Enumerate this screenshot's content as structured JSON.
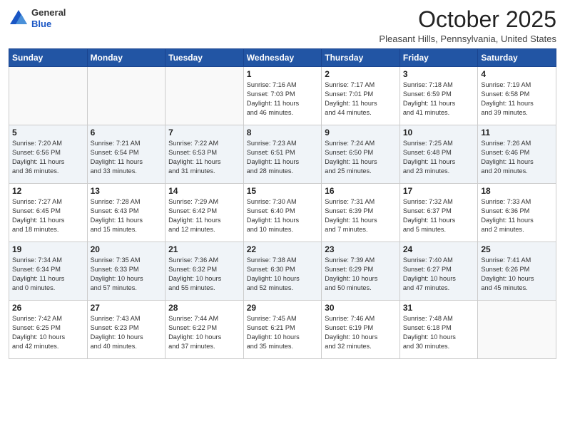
{
  "header": {
    "logo_general": "General",
    "logo_blue": "Blue",
    "month": "October 2025",
    "location": "Pleasant Hills, Pennsylvania, United States"
  },
  "days_of_week": [
    "Sunday",
    "Monday",
    "Tuesday",
    "Wednesday",
    "Thursday",
    "Friday",
    "Saturday"
  ],
  "weeks": [
    [
      {
        "num": "",
        "info": ""
      },
      {
        "num": "",
        "info": ""
      },
      {
        "num": "",
        "info": ""
      },
      {
        "num": "1",
        "info": "Sunrise: 7:16 AM\nSunset: 7:03 PM\nDaylight: 11 hours\nand 46 minutes."
      },
      {
        "num": "2",
        "info": "Sunrise: 7:17 AM\nSunset: 7:01 PM\nDaylight: 11 hours\nand 44 minutes."
      },
      {
        "num": "3",
        "info": "Sunrise: 7:18 AM\nSunset: 6:59 PM\nDaylight: 11 hours\nand 41 minutes."
      },
      {
        "num": "4",
        "info": "Sunrise: 7:19 AM\nSunset: 6:58 PM\nDaylight: 11 hours\nand 39 minutes."
      }
    ],
    [
      {
        "num": "5",
        "info": "Sunrise: 7:20 AM\nSunset: 6:56 PM\nDaylight: 11 hours\nand 36 minutes."
      },
      {
        "num": "6",
        "info": "Sunrise: 7:21 AM\nSunset: 6:54 PM\nDaylight: 11 hours\nand 33 minutes."
      },
      {
        "num": "7",
        "info": "Sunrise: 7:22 AM\nSunset: 6:53 PM\nDaylight: 11 hours\nand 31 minutes."
      },
      {
        "num": "8",
        "info": "Sunrise: 7:23 AM\nSunset: 6:51 PM\nDaylight: 11 hours\nand 28 minutes."
      },
      {
        "num": "9",
        "info": "Sunrise: 7:24 AM\nSunset: 6:50 PM\nDaylight: 11 hours\nand 25 minutes."
      },
      {
        "num": "10",
        "info": "Sunrise: 7:25 AM\nSunset: 6:48 PM\nDaylight: 11 hours\nand 23 minutes."
      },
      {
        "num": "11",
        "info": "Sunrise: 7:26 AM\nSunset: 6:46 PM\nDaylight: 11 hours\nand 20 minutes."
      }
    ],
    [
      {
        "num": "12",
        "info": "Sunrise: 7:27 AM\nSunset: 6:45 PM\nDaylight: 11 hours\nand 18 minutes."
      },
      {
        "num": "13",
        "info": "Sunrise: 7:28 AM\nSunset: 6:43 PM\nDaylight: 11 hours\nand 15 minutes."
      },
      {
        "num": "14",
        "info": "Sunrise: 7:29 AM\nSunset: 6:42 PM\nDaylight: 11 hours\nand 12 minutes."
      },
      {
        "num": "15",
        "info": "Sunrise: 7:30 AM\nSunset: 6:40 PM\nDaylight: 11 hours\nand 10 minutes."
      },
      {
        "num": "16",
        "info": "Sunrise: 7:31 AM\nSunset: 6:39 PM\nDaylight: 11 hours\nand 7 minutes."
      },
      {
        "num": "17",
        "info": "Sunrise: 7:32 AM\nSunset: 6:37 PM\nDaylight: 11 hours\nand 5 minutes."
      },
      {
        "num": "18",
        "info": "Sunrise: 7:33 AM\nSunset: 6:36 PM\nDaylight: 11 hours\nand 2 minutes."
      }
    ],
    [
      {
        "num": "19",
        "info": "Sunrise: 7:34 AM\nSunset: 6:34 PM\nDaylight: 11 hours\nand 0 minutes."
      },
      {
        "num": "20",
        "info": "Sunrise: 7:35 AM\nSunset: 6:33 PM\nDaylight: 10 hours\nand 57 minutes."
      },
      {
        "num": "21",
        "info": "Sunrise: 7:36 AM\nSunset: 6:32 PM\nDaylight: 10 hours\nand 55 minutes."
      },
      {
        "num": "22",
        "info": "Sunrise: 7:38 AM\nSunset: 6:30 PM\nDaylight: 10 hours\nand 52 minutes."
      },
      {
        "num": "23",
        "info": "Sunrise: 7:39 AM\nSunset: 6:29 PM\nDaylight: 10 hours\nand 50 minutes."
      },
      {
        "num": "24",
        "info": "Sunrise: 7:40 AM\nSunset: 6:27 PM\nDaylight: 10 hours\nand 47 minutes."
      },
      {
        "num": "25",
        "info": "Sunrise: 7:41 AM\nSunset: 6:26 PM\nDaylight: 10 hours\nand 45 minutes."
      }
    ],
    [
      {
        "num": "26",
        "info": "Sunrise: 7:42 AM\nSunset: 6:25 PM\nDaylight: 10 hours\nand 42 minutes."
      },
      {
        "num": "27",
        "info": "Sunrise: 7:43 AM\nSunset: 6:23 PM\nDaylight: 10 hours\nand 40 minutes."
      },
      {
        "num": "28",
        "info": "Sunrise: 7:44 AM\nSunset: 6:22 PM\nDaylight: 10 hours\nand 37 minutes."
      },
      {
        "num": "29",
        "info": "Sunrise: 7:45 AM\nSunset: 6:21 PM\nDaylight: 10 hours\nand 35 minutes."
      },
      {
        "num": "30",
        "info": "Sunrise: 7:46 AM\nSunset: 6:19 PM\nDaylight: 10 hours\nand 32 minutes."
      },
      {
        "num": "31",
        "info": "Sunrise: 7:48 AM\nSunset: 6:18 PM\nDaylight: 10 hours\nand 30 minutes."
      },
      {
        "num": "",
        "info": ""
      }
    ]
  ]
}
